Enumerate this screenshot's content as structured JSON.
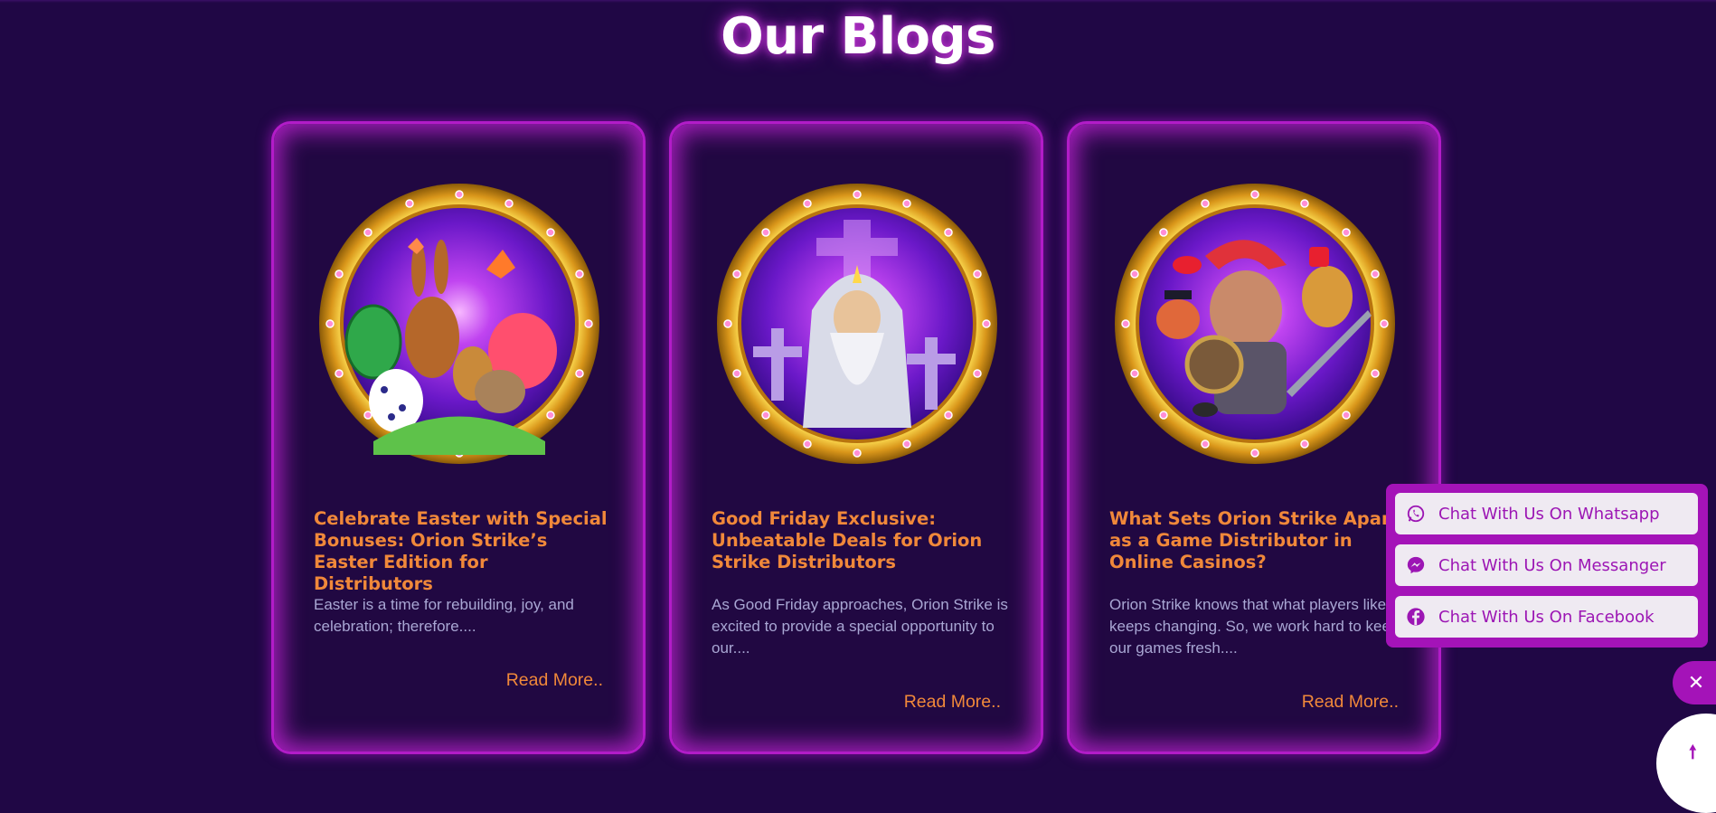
{
  "heading": "Our Blogs",
  "cards": [
    {
      "title": "Celebrate Easter with Special Bonuses: Orion Strike’s Easter Edition for Distributors",
      "excerpt": "Easter is a time for rebuilding, joy, and celebration; therefore....",
      "read_more": "Read More.."
    },
    {
      "title": "Good Friday Exclusive: Unbeatable Deals for Orion Strike Distributors",
      "excerpt": "As Good Friday approaches, Orion Strike is excited to provide a special opportunity to our....",
      "read_more": "Read More.."
    },
    {
      "title": "What Sets Orion Strike Apart as a Game Distributor in Online Casinos?",
      "excerpt": "Orion Strike knows that what players like keeps changing. So, we work hard to keep our games fresh....",
      "read_more": "Read More.."
    }
  ],
  "chat": {
    "whatsapp": "Chat With Us On Whatsapp",
    "messenger": "Chat With Us On Messanger",
    "facebook": "Chat With Us On Facebook"
  },
  "icons": {
    "close": "close-icon",
    "scroll_top": "arrow-up-icon"
  },
  "colors": {
    "background": "#200745",
    "accent_magenta": "#a413b8",
    "title_orange": "#f0883a",
    "excerpt_text": "#a9a7d4"
  }
}
